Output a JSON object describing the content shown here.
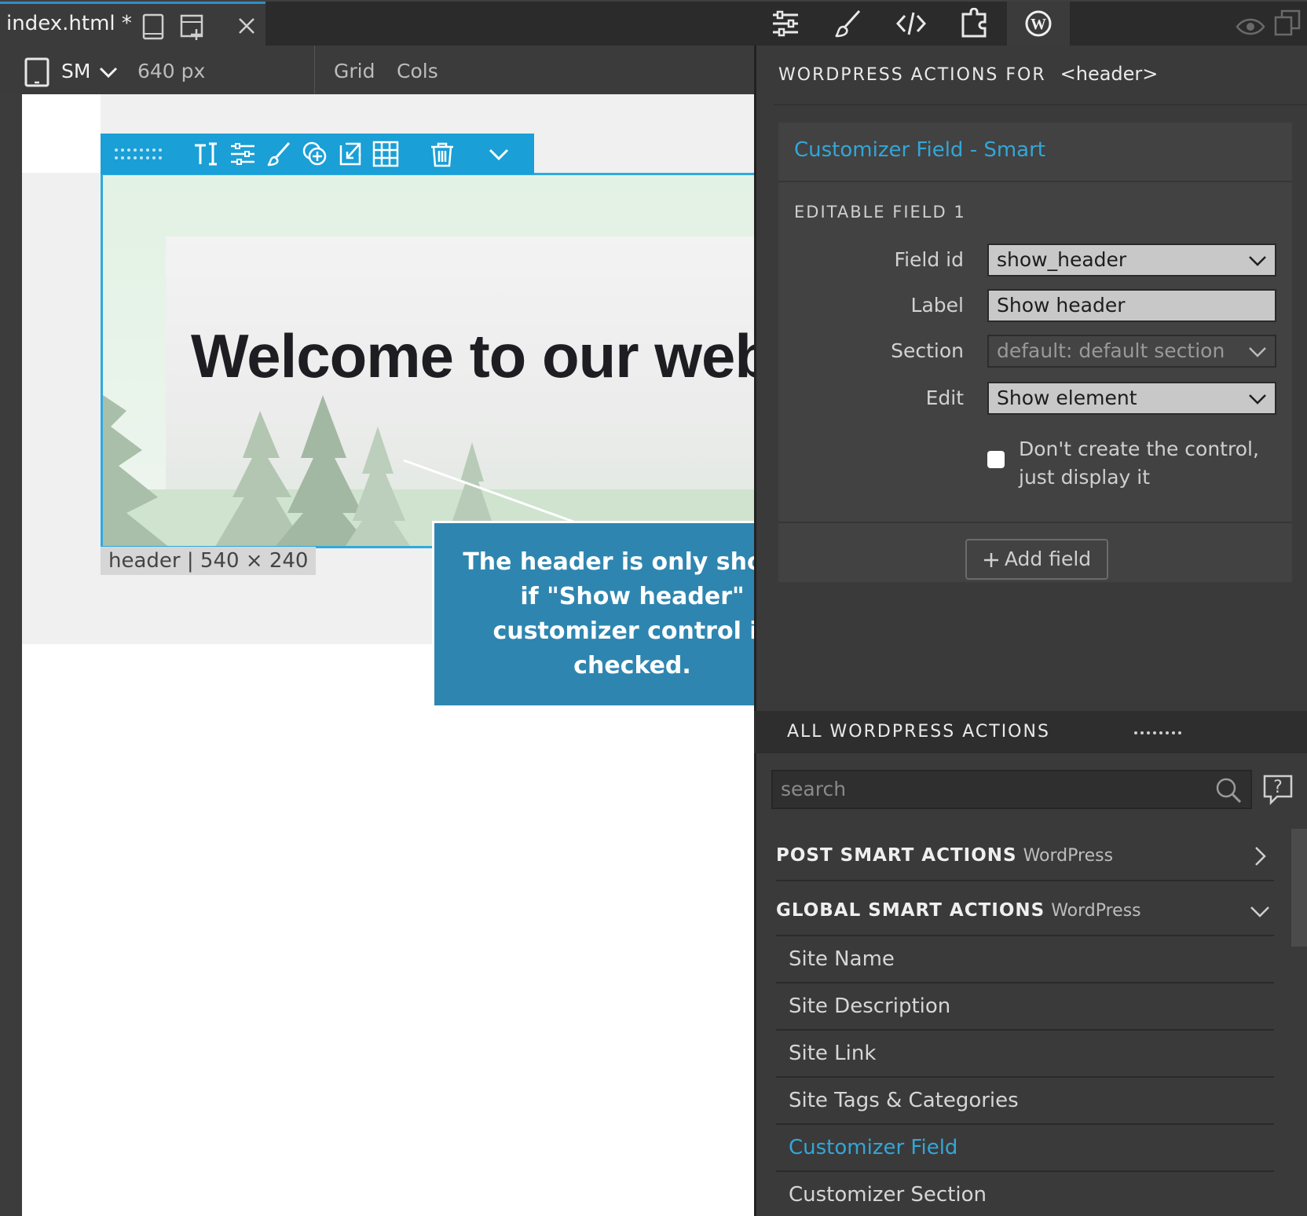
{
  "tab": {
    "title": "index.html *"
  },
  "subbar": {
    "breakpoint": "SM",
    "width": "640 px",
    "grid": "Grid",
    "cols": "Cols"
  },
  "selection": {
    "label": "header",
    "size": "540 × 240"
  },
  "header_preview": {
    "title": "Welcome to our webs"
  },
  "callout": {
    "text": "The header is only shown if \"Show header\" customizer control is checked."
  },
  "panel": {
    "heading": "WORDPRESS ACTIONS FOR",
    "heading_tag": "<header>",
    "card_title": "Customizer Field - Smart",
    "card_subtitle": "EDITABLE FIELD 1",
    "fields": {
      "field_id": {
        "label": "Field id",
        "value": "show_header"
      },
      "label": {
        "label": "Label",
        "value": "Show header"
      },
      "section": {
        "label": "Section",
        "value": "default: default section"
      },
      "edit": {
        "label": "Edit",
        "value": "Show element"
      }
    },
    "checkbox_label": "Don't create the control, just display it",
    "add_field": "Add field"
  },
  "all_actions": {
    "heading": "ALL WORDPRESS ACTIONS",
    "search_placeholder": "search",
    "groups": [
      {
        "title": "POST SMART ACTIONS",
        "sub": "WordPress"
      },
      {
        "title": "GLOBAL SMART ACTIONS",
        "sub": "WordPress"
      }
    ],
    "items": [
      "Site Name",
      "Site Description",
      "Site Link",
      "Site Tags & Categories",
      "Customizer Field",
      "Customizer Section"
    ]
  },
  "colors": {
    "accent": "#33a6d8",
    "callout": "#2e86b0",
    "toolbar": "#1a9fd6"
  }
}
